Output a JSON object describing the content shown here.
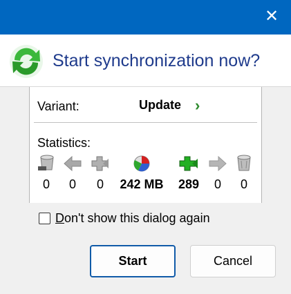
{
  "dialog": {
    "heading": "Start synchronization now?",
    "close_glyph": "✕"
  },
  "variant": {
    "label": "Variant:",
    "value": "Update",
    "chevron": "›"
  },
  "statistics": {
    "label": "Statistics:",
    "items": [
      {
        "icon": "delete-left-icon",
        "value": "0"
      },
      {
        "icon": "arrow-left-icon",
        "value": "0"
      },
      {
        "icon": "create-left-icon",
        "value": "0"
      },
      {
        "icon": "data-pie-icon",
        "value": "242 MB"
      },
      {
        "icon": "create-right-icon",
        "value": "289"
      },
      {
        "icon": "arrow-right-icon",
        "value": "0"
      },
      {
        "icon": "delete-right-icon",
        "value": "0"
      }
    ]
  },
  "checkbox": {
    "label_prefix": "D",
    "label_rest": "on't show this dialog again",
    "checked": false
  },
  "buttons": {
    "start_label": "Start",
    "cancel_label": "Cancel"
  },
  "colors": {
    "titlebar": "#0067c0",
    "heading": "#1f3b8c",
    "accent_green": "#2e8b2e",
    "primary_border": "#0f5aa8"
  }
}
